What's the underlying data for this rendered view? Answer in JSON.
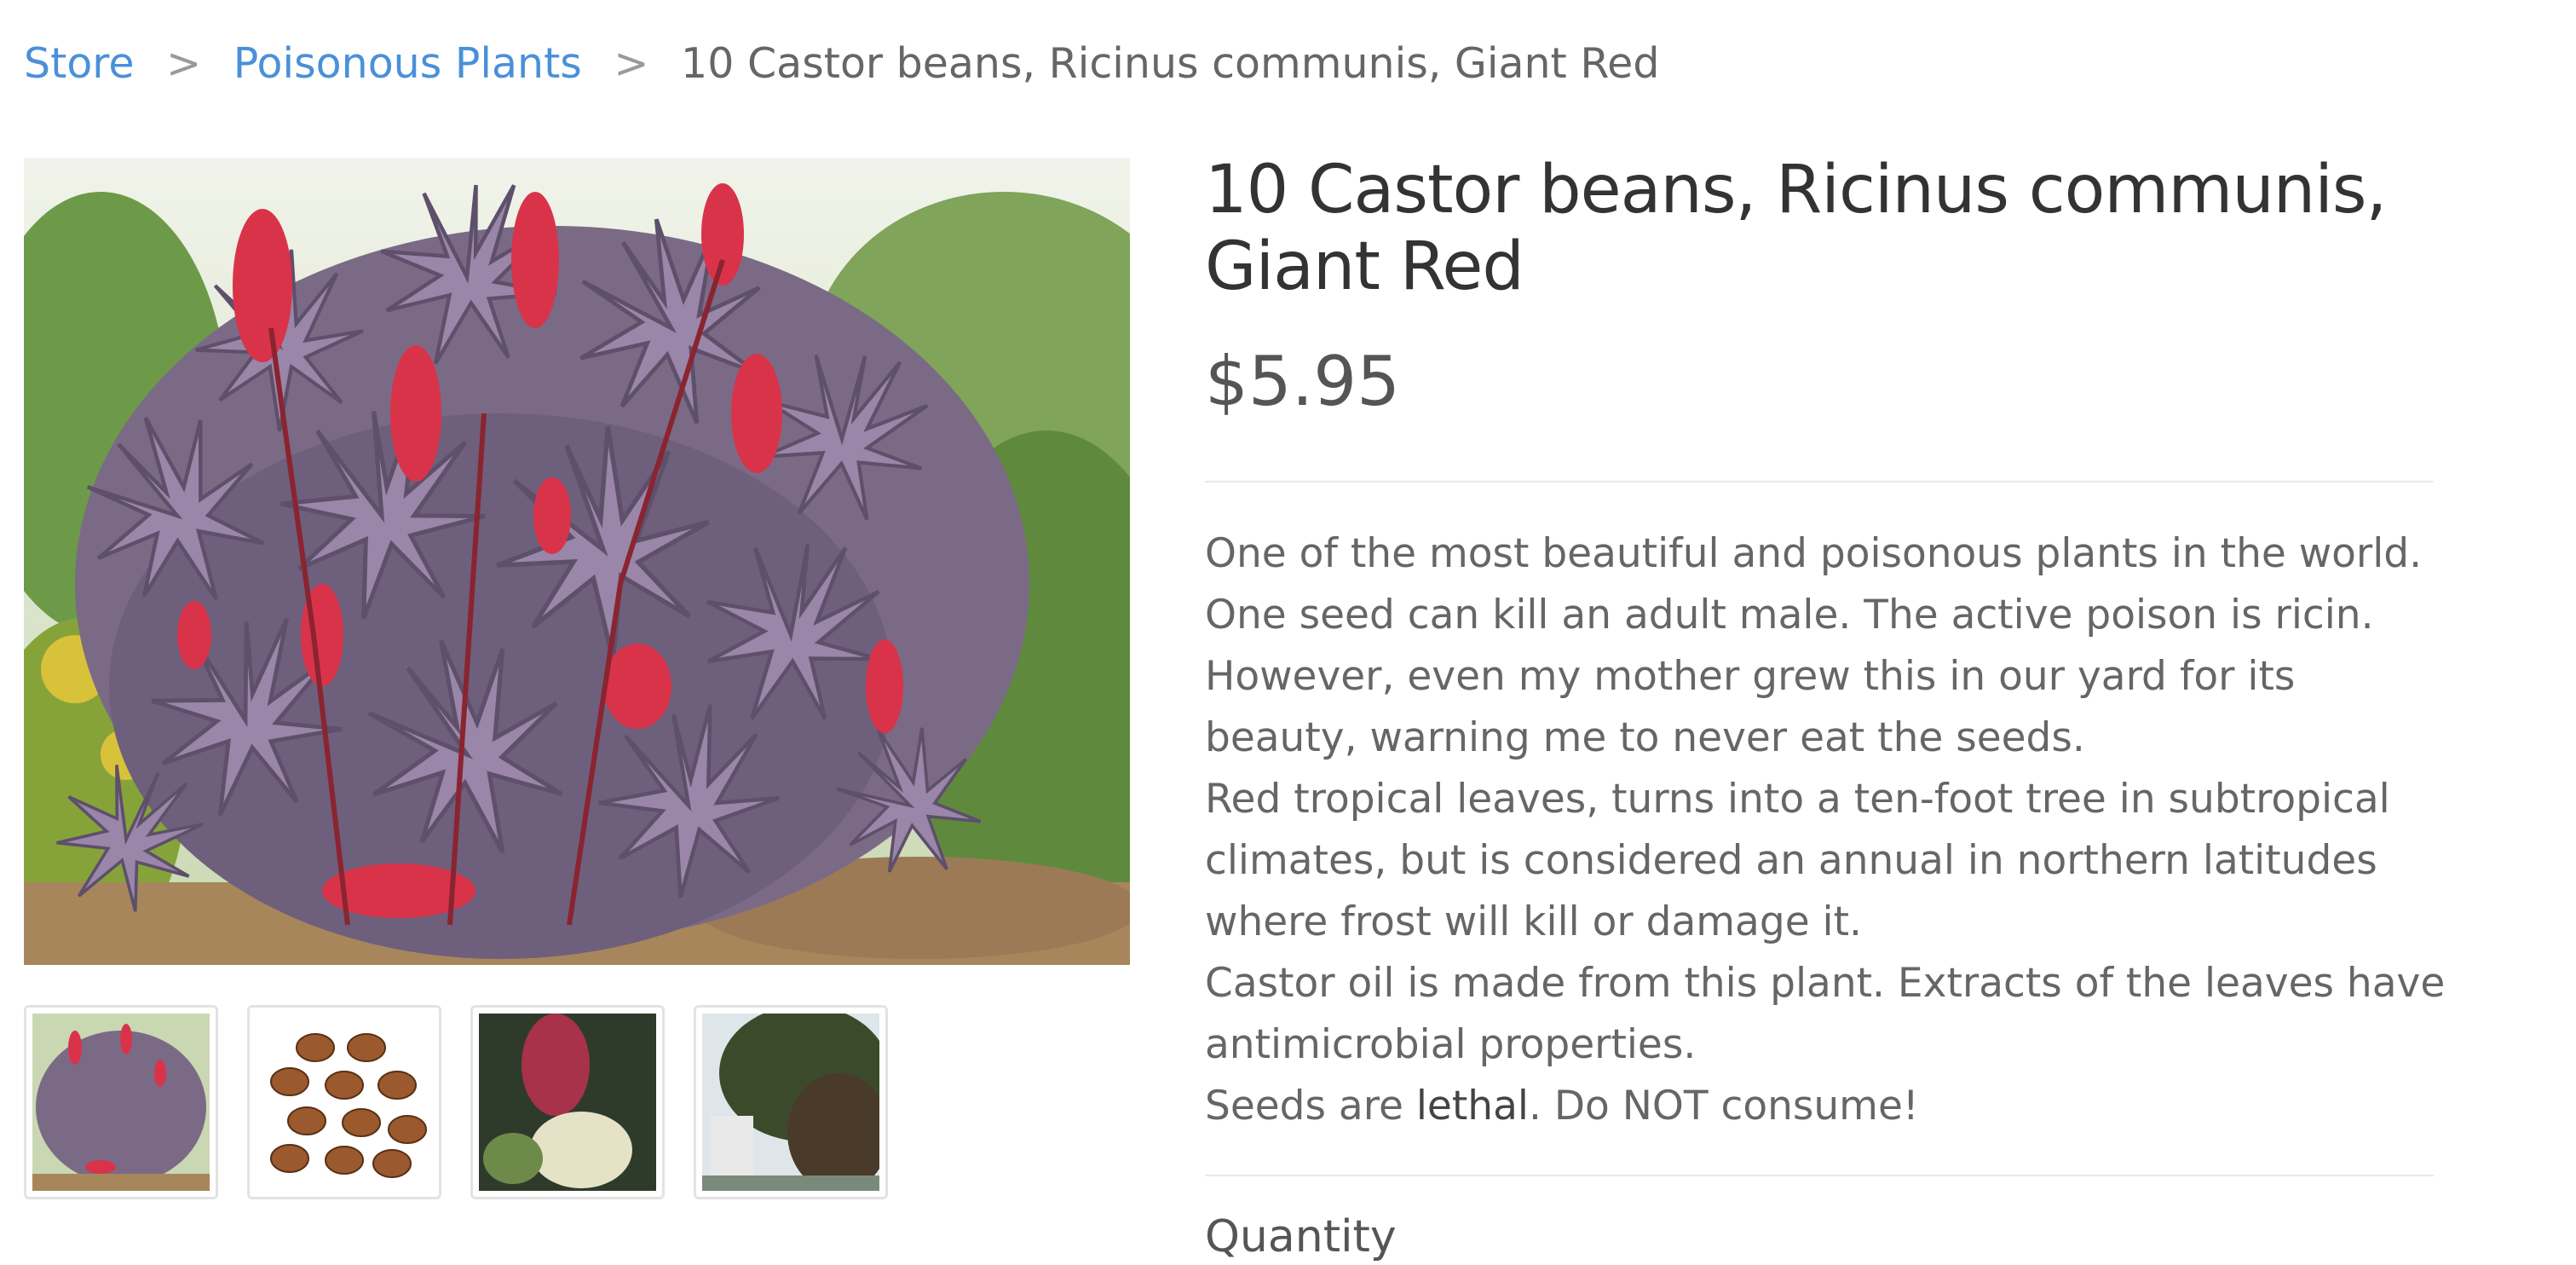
{
  "breadcrumb": {
    "items": [
      "Store",
      "Poisonous Plants"
    ],
    "separator": ">",
    "current": "10 Castor beans, Ricinus communis, Giant Red"
  },
  "product": {
    "title": "10 Castor beans, Ricinus communis, Giant Red",
    "price": "$5.95",
    "description": {
      "p1": "One of the most beautiful and poisonous plants in the world. One seed can kill an adult male. The active poison is ricin. However, even my mother grew this in our yard for its beauty, warning me to never eat the seeds.",
      "p2": "Red tropical leaves, turns into a ten-foot tree in subtropical climates, but is considered an annual in northern latitudes where frost will kill or damage it.",
      "p3": "Castor oil is made from this plant. Extracts of the leaves have antimicrobial properties.",
      "p4_before": "Seeds are ",
      "p4_bold": "lethal",
      "p4_after": ". Do NOT consume!"
    },
    "quantity_label": "Quantity"
  },
  "colors": {
    "link": "#4a90d9",
    "title": "#333333",
    "text": "#666666",
    "leaf_purple": "#8a6f96",
    "flower_red": "#d9334a",
    "foliage_green": "#5f8a3e"
  },
  "icons": {
    "breadcrumb_separator": "chevron-right"
  }
}
